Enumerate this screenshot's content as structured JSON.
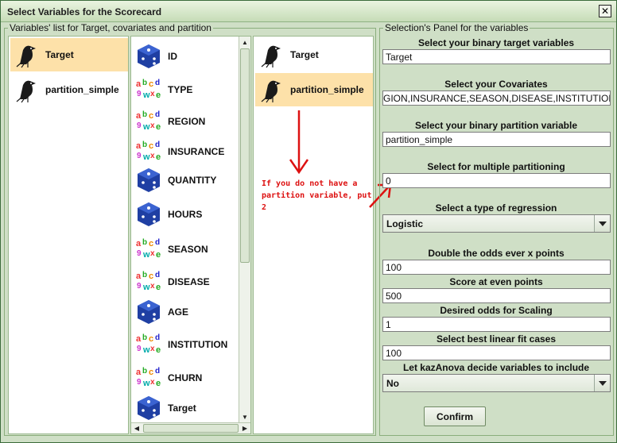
{
  "window": {
    "title": "Select Variables for the Scorecard"
  },
  "left_group": {
    "title": "Variables' list for Target, covariates and partition"
  },
  "right_group": {
    "title": "Selection's Panel for the variables"
  },
  "list1": {
    "items": [
      {
        "label": "Target",
        "icon": "crow-icon"
      },
      {
        "label": "partition_simple",
        "icon": "crow-icon"
      }
    ]
  },
  "list2": {
    "items": [
      {
        "label": "ID",
        "icon": "dice-icon"
      },
      {
        "label": "TYPE",
        "icon": "letters-icon"
      },
      {
        "label": "REGION",
        "icon": "letters-icon"
      },
      {
        "label": "INSURANCE",
        "icon": "letters-icon"
      },
      {
        "label": "QUANTITY",
        "icon": "dice-icon"
      },
      {
        "label": "HOURS",
        "icon": "dice-icon"
      },
      {
        "label": "SEASON",
        "icon": "letters-icon"
      },
      {
        "label": "DISEASE",
        "icon": "letters-icon"
      },
      {
        "label": "AGE",
        "icon": "dice-icon"
      },
      {
        "label": "INSTITUTION",
        "icon": "letters-icon"
      },
      {
        "label": "CHURN",
        "icon": "letters-icon"
      },
      {
        "label": "Target",
        "icon": "dice-icon"
      }
    ]
  },
  "list3": {
    "items": [
      {
        "label": "Target",
        "icon": "crow-icon"
      },
      {
        "label": "partition_simple",
        "icon": "crow-icon"
      }
    ]
  },
  "annotation": {
    "text": "If you do not have a partition variable, put 2",
    "color": "#d11111"
  },
  "form": {
    "target_label": "Select your binary target variables",
    "target_value": "Target",
    "covariates_label": "Select your Covariates",
    "covariates_value": "GION,INSURANCE,SEASON,DISEASE,INSTITUTION",
    "partition_label": "Select your binary partition variable",
    "partition_value": "partition_simple",
    "multiple_label": "Select for multiple partitioning",
    "multiple_value": "0",
    "regression_label": "Select a type of regression",
    "regression_value": "Logistic",
    "odds_label": "Double the odds ever x points",
    "odds_value": "100",
    "score_label": "Score at even points",
    "score_value": "500",
    "scaling_label": "Desired odds for Scaling",
    "scaling_value": "1",
    "linear_label": "Select best linear fit cases",
    "linear_value": "100",
    "decide_label": "Let kazAnova decide variables to include",
    "decide_value": "No",
    "confirm_label": "Confirm"
  },
  "colors": {
    "selected_bg": "#fde1a9",
    "window_bg": "#cfdfc6",
    "accent": "#3b6b3b"
  }
}
